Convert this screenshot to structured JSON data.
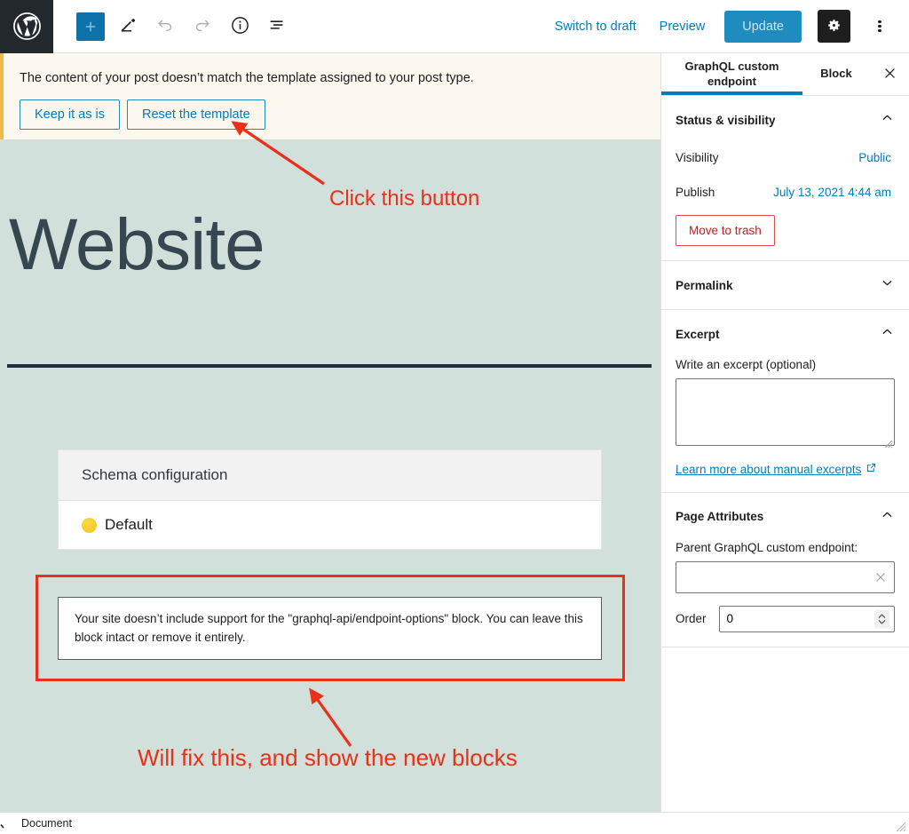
{
  "toolbar": {
    "logo_icon": "wordpress-logo-icon",
    "add_block_label": "+",
    "add_block_icon": "plus-icon",
    "edit_icon": "pencil-icon",
    "undo_icon": "undo-icon",
    "redo_icon": "redo-icon",
    "info_icon": "info-icon",
    "list_view_icon": "list-view-icon",
    "switch_to_draft_label": "Switch to draft",
    "preview_label": "Preview",
    "update_label": "Update",
    "settings_icon": "gear-icon",
    "more_options_icon": "kebab-menu-icon",
    "accent_color": "#007cba",
    "update_button_color": "#1e8cbe"
  },
  "notice": {
    "message": "The content of your post doesn’t match the template assigned to your post type.",
    "keep_label": "Keep it as is",
    "reset_label": "Reset the template",
    "border_color": "#f0b849",
    "background_color": "#fdf8ef"
  },
  "canvas": {
    "background_color": "#d1e0da",
    "post_title": "Website",
    "separator_color": "#22313b",
    "schema_block": {
      "header": "Schema configuration",
      "status_icon": "yellow-circle-icon",
      "status_color": "#f0c419",
      "value": "Default"
    },
    "missing_block": {
      "message": "Your site doesn’t include support for the \"graphql-api/endpoint-options\" block. You can leave this block intact or remove it entirely."
    }
  },
  "annotations": {
    "color": "#e8301a",
    "top_note": "Click this button",
    "bottom_note": "Will fix this, and show the new blocks"
  },
  "sidebar": {
    "tabs": [
      {
        "label": "GraphQL custom endpoint",
        "active": true
      },
      {
        "label": "Block",
        "active": false
      }
    ],
    "close_icon": "close-icon",
    "panels": {
      "status_visibility": {
        "title": "Status & visibility",
        "expanded": true,
        "collapse_icon": "chevron-up-icon",
        "visibility_label": "Visibility",
        "visibility_value": "Public",
        "publish_label": "Publish",
        "publish_value": "July 13, 2021 4:44 am",
        "trash_label": "Move to trash",
        "trash_color": "#cc1818"
      },
      "permalink": {
        "title": "Permalink",
        "expanded": false,
        "expand_icon": "chevron-down-icon"
      },
      "excerpt": {
        "title": "Excerpt",
        "expanded": true,
        "collapse_icon": "chevron-up-icon",
        "field_label": "Write an excerpt (optional)",
        "field_value": "",
        "field_placeholder": "",
        "learn_more_label": "Learn more about manual excerpts",
        "external_icon": "external-link-icon"
      },
      "page_attributes": {
        "title": "Page Attributes",
        "expanded": true,
        "collapse_icon": "chevron-up-icon",
        "parent_label": "Parent GraphQL custom endpoint:",
        "parent_value": "",
        "clear_icon": "close-x-icon",
        "order_label": "Order",
        "order_value": "0",
        "spinner_icon": "stepper-updown-icon"
      }
    }
  },
  "statusbar": {
    "document_label": "Document",
    "resize_icon": "resize-grip-icon"
  }
}
